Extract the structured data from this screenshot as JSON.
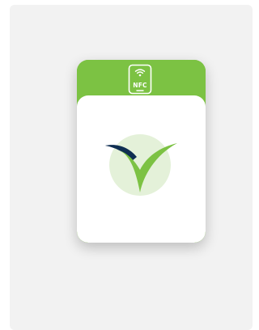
{
  "card": {
    "badge_icon": "nfc-phone-icon",
    "badge_label": "NFC",
    "logo_icon": "green-check-logo-icon"
  },
  "colors": {
    "background": "#f2f2f2",
    "accent_green": "#7cc243",
    "navy": "#0f2e52",
    "logo_circle": "#e4f1d9",
    "card": "#ffffff"
  }
}
